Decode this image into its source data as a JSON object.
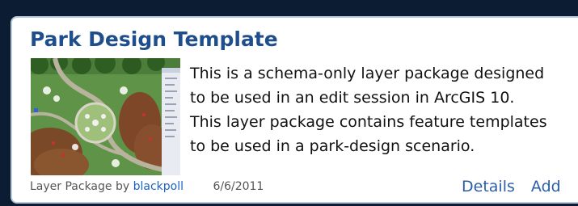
{
  "item": {
    "title": "Park Design Template",
    "description_lines": [
      "This is a schema-only layer package designed",
      "to be used in an edit session in ArcGIS 10.",
      "This layer package contains feature templates",
      "to be used in a park-design scenario."
    ],
    "type_label": "Layer Package by",
    "owner": "blackpoll",
    "date": "6/6/2011",
    "details_label": "Details",
    "add_label": "Add"
  },
  "colors": {
    "page_background": "#0b1c33",
    "card_border": "#b7c9dd",
    "title": "#1f4e8c",
    "link": "#2a5ea8",
    "owner_link": "#1b63c6"
  },
  "thumbnail": {
    "icon": "map-thumbnail"
  }
}
